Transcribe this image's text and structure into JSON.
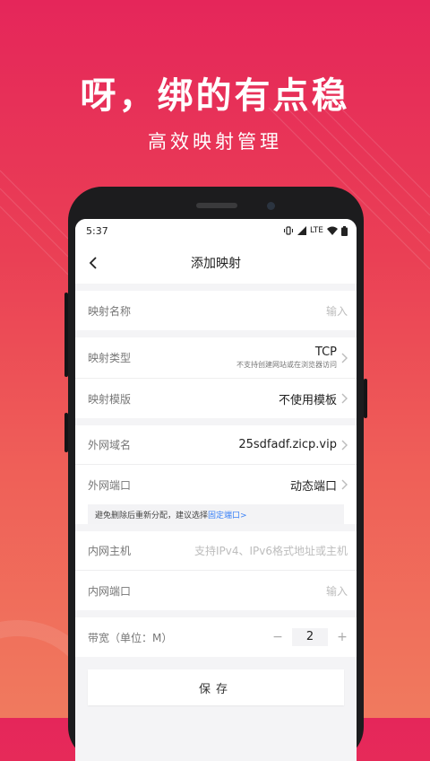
{
  "hero": {
    "title": "呀，绑的有点稳",
    "subtitle": "高效映射管理"
  },
  "statusbar": {
    "time": "5:37",
    "network": "LTE",
    "icons": [
      "vibrate-icon",
      "signal-icon",
      "wifi-icon",
      "battery-icon"
    ]
  },
  "nav": {
    "title": "添加映射",
    "back_icon": "chevron-left-icon"
  },
  "form": {
    "name": {
      "label": "映射名称",
      "placeholder": "输入"
    },
    "type": {
      "label": "映射类型",
      "value": "TCP",
      "note": "不支持创建网站或在浏览器访问"
    },
    "template": {
      "label": "映射模版",
      "value": "不使用模板"
    },
    "domain": {
      "label": "外网域名",
      "value": "25sdfadf.zicp.vip"
    },
    "ext_port": {
      "label": "外网端口",
      "value": "动态端口"
    },
    "tip": {
      "text": "避免删除后重新分配，建议选择",
      "link": "固定端口>"
    },
    "host": {
      "label": "内网主机",
      "placeholder": "支持IPv4、IPv6格式地址或主机"
    },
    "int_port": {
      "label": "内网端口",
      "placeholder": "输入"
    },
    "bandwidth": {
      "label": "带宽（单位：M）",
      "minus": "−",
      "value": "2",
      "plus": "+"
    }
  },
  "actions": {
    "save_label": "保存"
  },
  "colors": {
    "gradient_top": "#e5265a",
    "gradient_bottom": "#f07a5e",
    "link": "#3b82f6"
  }
}
